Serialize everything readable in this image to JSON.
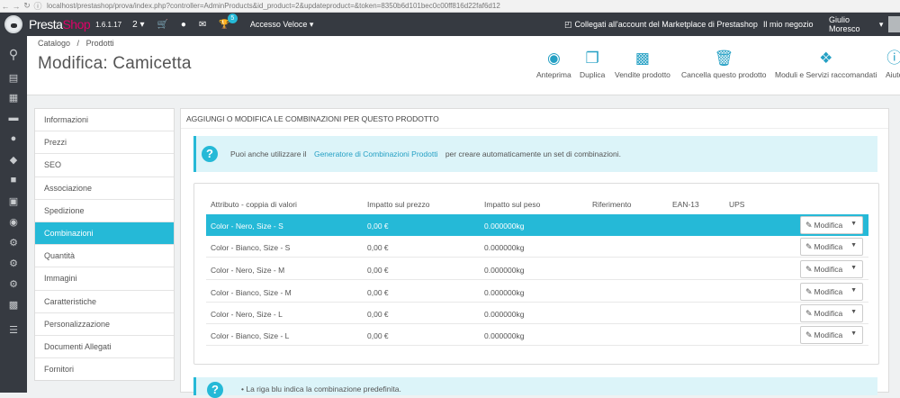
{
  "browser": {
    "url": "localhost/prestashop/prova/index.php?controller=AdminProducts&id_product=2&updateproduct=&token=8350b6d101bec0c00ff816d22faf6d12"
  },
  "topbar": {
    "brand_prefix": "Presta",
    "brand_suffix": "Shop",
    "version": "1.6.1.17",
    "orders_count": "2",
    "notification_badge": "5",
    "quick_access": "Accesso Veloce",
    "marketplace": "Collegati all'account del Marketplace di Prestashop",
    "my_shop": "Il mio negozio",
    "user": "Giulio Moresco"
  },
  "header": {
    "breadcrumb_parent": "Catalogo",
    "breadcrumb_sep": "/",
    "breadcrumb_current": "Prodotti",
    "title": "Modifica: Camicetta",
    "toolbar": [
      {
        "label": "Anteprima",
        "icon": "eye-icon"
      },
      {
        "label": "Duplica",
        "icon": "copy-icon"
      },
      {
        "label": "Vendite prodotto",
        "icon": "bar-chart-icon"
      },
      {
        "label": "Cancella questo prodotto",
        "icon": "trash-icon"
      },
      {
        "label": "Moduli e Servizi raccomandati",
        "icon": "puzzle-icon"
      },
      {
        "label": "Aiuto",
        "icon": "help-icon"
      }
    ]
  },
  "tabs": [
    "Informazioni",
    "Prezzi",
    "SEO",
    "Associazione",
    "Spedizione",
    "Combinazioni",
    "Quantità",
    "Immagini",
    "Caratteristiche",
    "Personalizzazione",
    "Documenti Allegati",
    "Fornitori"
  ],
  "active_tab": "Combinazioni",
  "panel": {
    "heading": "Aggiungi o modifica le combinazioni per questo prodotto",
    "info_prefix": "Puoi anche utilizzare il",
    "info_link": "Generatore di Combinazioni Prodotti",
    "info_suffix": "per creare automaticamente un set di combinazioni.",
    "columns": {
      "attribute": "Attributo - coppia di valori",
      "price_impact": "Impatto sul prezzo",
      "weight_impact": "Impatto sul peso",
      "reference": "Riferimento",
      "ean13": "EAN-13",
      "upc": "UPS"
    },
    "rows": [
      {
        "attribute": "Color - Nero, Size - S",
        "price": "0,00 €",
        "weight": "0.000000kg",
        "button": "Modifica"
      },
      {
        "attribute": "Color - Bianco, Size - S",
        "price": "0,00 €",
        "weight": "0.000000kg",
        "button": "Modifica"
      },
      {
        "attribute": "Color - Nero, Size - M",
        "price": "0,00 €",
        "weight": "0.000000kg",
        "button": "Modifica"
      },
      {
        "attribute": "Color - Bianco, Size - M",
        "price": "0,00 €",
        "weight": "0.000000kg",
        "button": "Modifica"
      },
      {
        "attribute": "Color - Nero, Size - L",
        "price": "0,00 €",
        "weight": "0.000000kg",
        "button": "Modifica"
      },
      {
        "attribute": "Color - Bianco, Size - L",
        "price": "0,00 €",
        "weight": "0.000000kg",
        "button": "Modifica"
      }
    ],
    "default_note": "La riga blu indica la combinazione predefinita."
  },
  "colors": {
    "accent": "#25b9d7",
    "topbar": "#363a41"
  }
}
